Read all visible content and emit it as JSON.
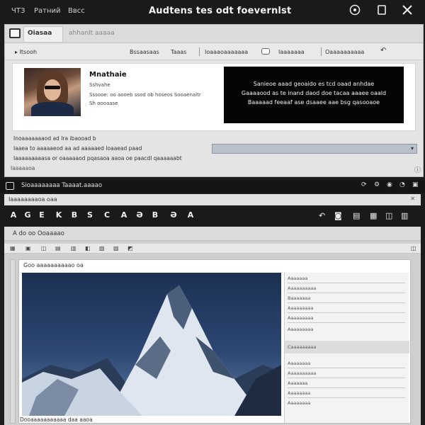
{
  "titlebar": {
    "menu": [
      "ЧТЗ",
      "Ратний",
      "Ввcс"
    ],
    "title": "Audtens tes odt foevernlst",
    "buttons": [
      "help-icon",
      "restore-icon",
      "close-icon"
    ]
  },
  "upper": {
    "tabs": [
      "Оiasaa",
      "ahhanlt aaaaa"
    ],
    "toolbar": {
      "back_label": "Itsooh",
      "items": [
        "Bssaasaas",
        "Taaas",
        "Ioaaaoaaaaaaa",
        "Iaaaaaaa",
        "Oaaaaaaaaaa"
      ]
    },
    "profile": {
      "name": "Mnathaie",
      "lines": [
        "Sshvahe",
        "Sssooe: oo aooeb ssod ob hoseos Sooaenaltr",
        "Sh oooaase"
      ]
    },
    "callout_lines": [
      "Sanieoe aaad geoaido es tcd oaad anhdae",
      "Gaaaaood as te inand daod doe tacaa aaaee oaald",
      "Baaaaad feeaaf ase dsaaee aae bsg qasooaoe"
    ],
    "info_lines": [
      "Inoaaaaaaaod ad Ira ibaooad b",
      "Iaaea to aaaaaeod aa ad aaaaaed Ioaaead paad",
      "Iaaaaaaaaasa or oaaaaaod pqasaoa aaoa oe paacdl qaaaaaabt"
    ],
    "dropdown_value": "",
    "footer": "Iaaaaaoa"
  },
  "lower": {
    "title": "Sioaaaaaaaa Taaaat.aaaao",
    "menu_label": "Iaaaaaaaaoa oaa",
    "format_buttons": [
      "A",
      "G",
      "E",
      "K",
      "B",
      "S",
      "C",
      "A",
      "Ә",
      "B",
      "Ә",
      "A"
    ],
    "doc_header": "A do oo Ooaaaao",
    "doc_page_header": "Goo aaaaaaaaaao oa",
    "side_labels": [
      "Aaaaaaa",
      "Aaaaaaaaaa",
      "Baaaaaaa",
      "Aaaaaaaaa",
      "Aaaaaaaaa",
      "Aaaaaaaaa",
      "Caaaaaaaaa",
      "Aaaaaaaa",
      "Aaaaaaaaaa",
      "Aaaaaaa",
      "Aaaaaaaa",
      "Aaaaaaaa"
    ],
    "footer": "Dooaaaaaaaaaaa daa aaoa"
  }
}
